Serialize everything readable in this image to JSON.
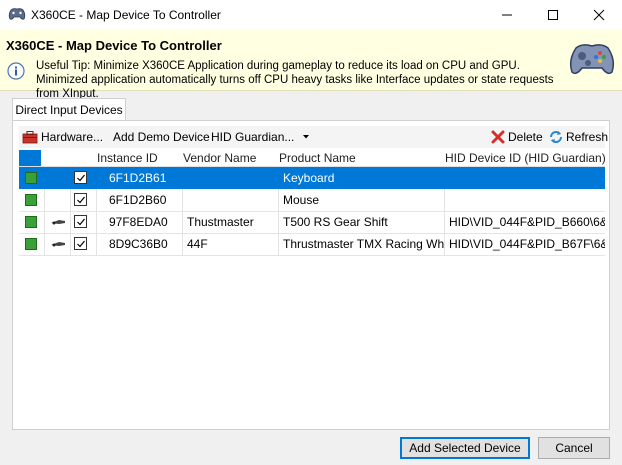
{
  "window": {
    "title": "X360CE - Map Device To Controller"
  },
  "banner": {
    "title": "X360CE - Map Device To Controller",
    "tip": "Useful Tip: Minimize X360CE Application during gameplay to reduce its load on CPU and GPU. Minimized application automatically turns off CPU heavy tasks like Interface updates or state requests from XInput."
  },
  "tabs": [
    {
      "label": "Direct Input Devices"
    }
  ],
  "toolbar": {
    "hardware_label": "Hardware...",
    "add_demo_label": "Add Demo Device",
    "hid_guardian_label": "HID Guardian...",
    "delete_label": "Delete",
    "refresh_label": "Refresh"
  },
  "grid": {
    "columns": {
      "instance_id": "Instance ID",
      "vendor_name": "Vendor Name",
      "product_name": "Product Name",
      "hid_device_id": "HID Device ID (HID Guardian)"
    },
    "rows": [
      {
        "instance_id": "6F1D2B61",
        "vendor_name": "",
        "product_name": "Keyboard",
        "hid_device_id": "",
        "checked": true,
        "has_device_icon": false,
        "selected": true
      },
      {
        "instance_id": "6F1D2B60",
        "vendor_name": "",
        "product_name": "Mouse",
        "hid_device_id": "",
        "checked": true,
        "has_device_icon": false,
        "selected": false
      },
      {
        "instance_id": "97F8EDA0",
        "vendor_name": "Thustmaster",
        "product_name": "T500 RS Gear Shift",
        "hid_device_id": "HID\\VID_044F&PID_B660\\6&...",
        "checked": true,
        "has_device_icon": true,
        "selected": false
      },
      {
        "instance_id": "8D9C36B0",
        "vendor_name": "44F",
        "product_name": "Thrustmaster TMX Racing Wheel",
        "hid_device_id": "HID\\VID_044F&PID_B67F\\6&...",
        "checked": true,
        "has_device_icon": true,
        "selected": false
      }
    ]
  },
  "footer": {
    "add_selected_label": "Add Selected Device",
    "cancel_label": "Cancel"
  },
  "colors": {
    "selection": "#0078d7",
    "banner_bg": "#ffffe1",
    "status_green": "#3aa13a"
  }
}
